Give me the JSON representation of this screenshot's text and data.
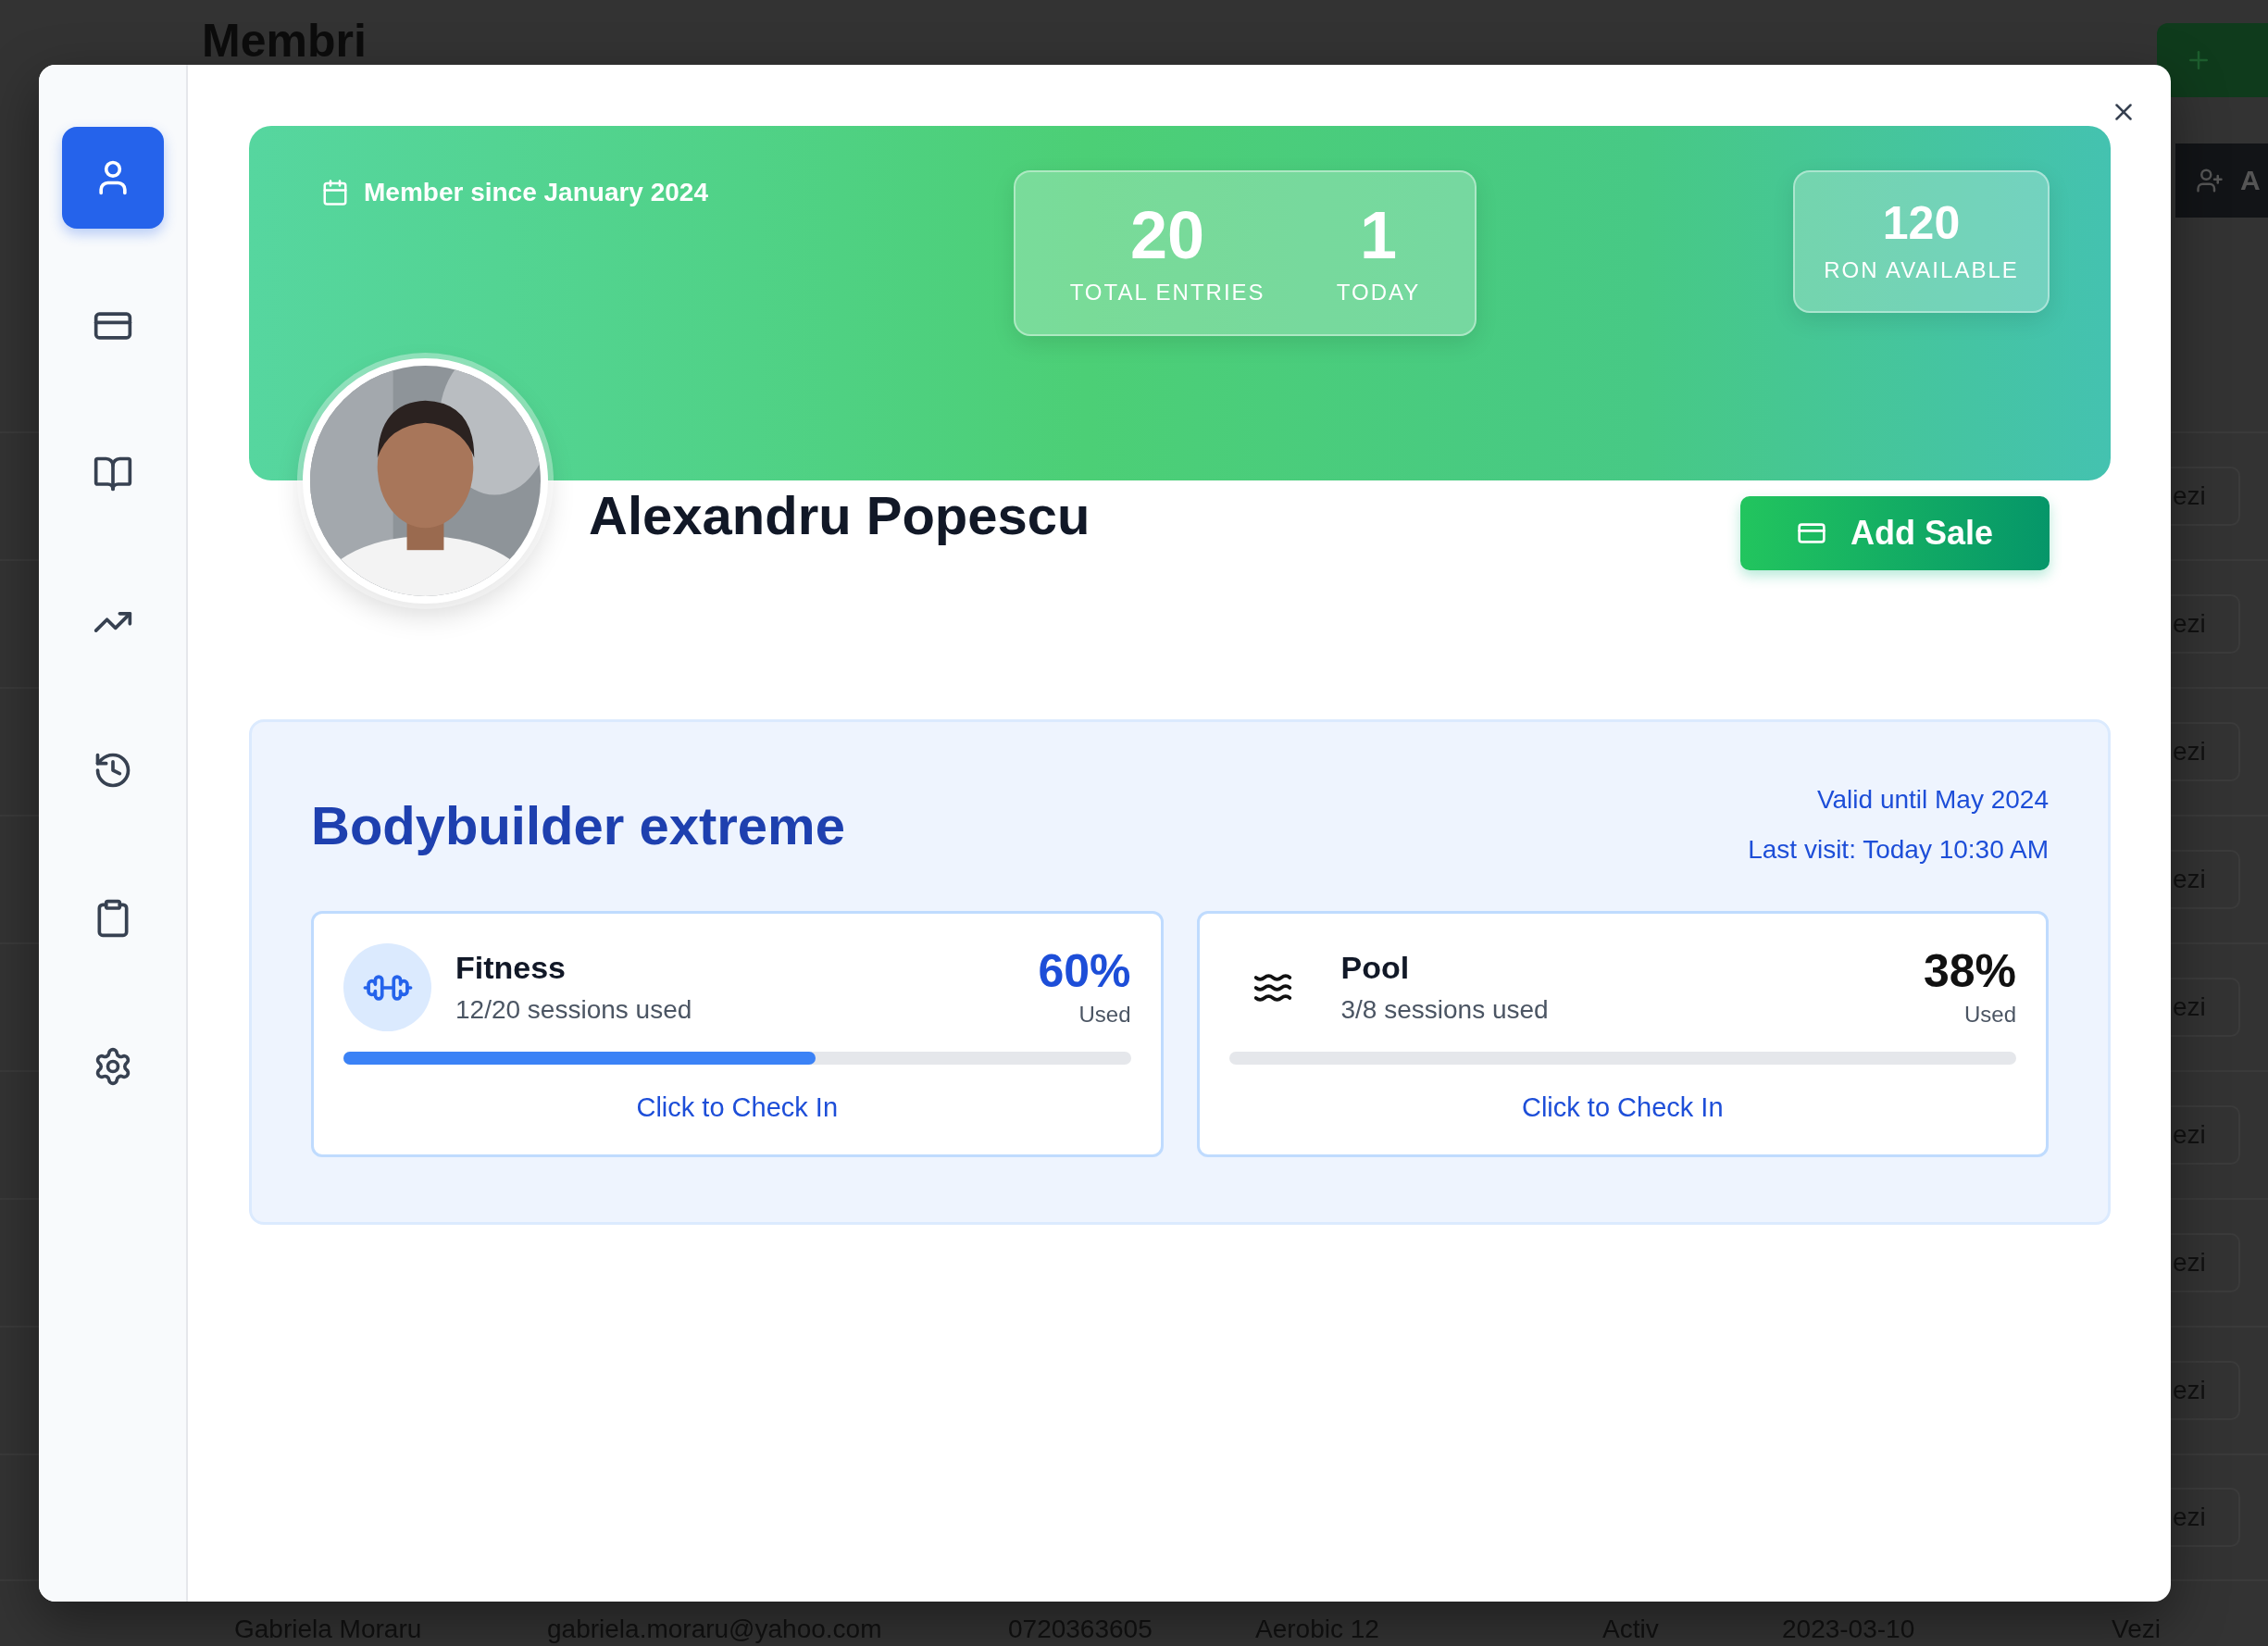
{
  "background_page": {
    "title": "Membri",
    "toolbar_text": "A",
    "row_actions": [
      "ezi",
      "ezi",
      "ezi",
      "ezi",
      "ezi",
      "ezi",
      "ezi",
      "ezi",
      "ezi"
    ],
    "partial_row": [
      "Gabriela Moraru",
      "gabriela.moraru@yahoo.com",
      "0720363605",
      "Aerobic 12",
      "Activ",
      "2023-03-10",
      "Vezi"
    ]
  },
  "sidebar": {
    "items": [
      {
        "selected": true
      },
      {
        "selected": false
      },
      {
        "selected": false
      },
      {
        "selected": false
      },
      {
        "selected": false
      },
      {
        "selected": false
      },
      {
        "selected": false
      }
    ]
  },
  "profile": {
    "member_since": "Member since January 2024",
    "stats": [
      {
        "value": "20",
        "label": "TOTAL ENTRIES"
      },
      {
        "value": "1",
        "label": "TODAY"
      }
    ],
    "balance": {
      "value": "120",
      "label": "RON AVAILABLE"
    },
    "name": "Alexandru Popescu",
    "add_sale_button": "Add Sale"
  },
  "plan": {
    "name": "Bodybuilder extreme",
    "valid_until": "Valid until May 2024",
    "last_visit": "Last visit: Today 10:30 AM",
    "services": [
      {
        "name": "Fitness",
        "sessions": "12/20 sessions used",
        "percent": "60%",
        "percent_label": "Used",
        "level": 0.6,
        "selected": true,
        "action": "Click to Check In"
      },
      {
        "name": "Pool",
        "sessions": "3/8 sessions used",
        "percent": "38%",
        "percent_label": "Used",
        "level": 0,
        "selected": false,
        "action": "Click to Check In"
      }
    ]
  }
}
